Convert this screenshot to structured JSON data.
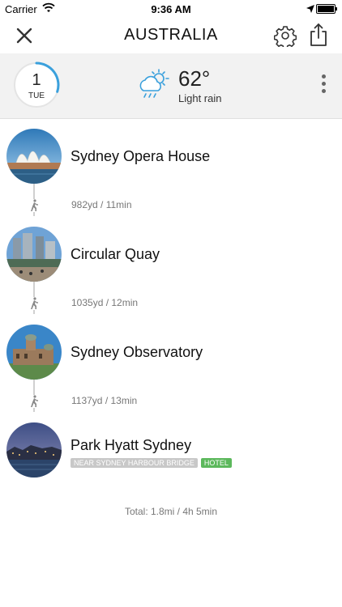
{
  "status_bar": {
    "carrier": "Carrier",
    "time": "9:36 AM"
  },
  "nav": {
    "title": "AUSTRALIA"
  },
  "day": {
    "number": "1",
    "weekday": "TUE",
    "progress": 0.3
  },
  "weather": {
    "temperature": "62°",
    "condition": "Light rain"
  },
  "stops": [
    {
      "name": "Sydney Opera House"
    },
    {
      "name": "Circular Quay"
    },
    {
      "name": "Sydney Observatory"
    },
    {
      "name": "Park Hyatt Sydney",
      "tags": [
        "NEAR SYDNEY HARBOUR BRIDGE",
        "HOTEL"
      ]
    }
  ],
  "legs": [
    {
      "text": "982yd / 11min"
    },
    {
      "text": "1035yd / 12min"
    },
    {
      "text": "1137yd / 13min"
    }
  ],
  "total": "Total: 1.8mi / 4h 5min",
  "colors": {
    "accent": "#3aa0dc",
    "hotel": "#5cb85c",
    "tag": "#c8c8c8"
  }
}
